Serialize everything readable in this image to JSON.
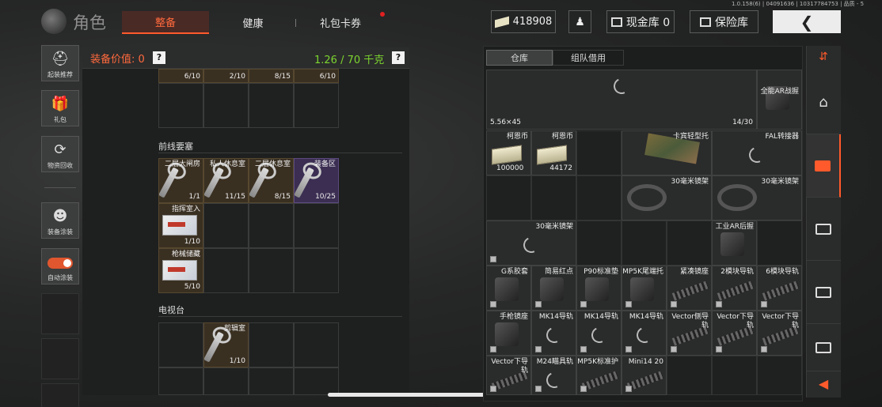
{
  "version": "1.0.158(6) | 04091636 | 10317784753 | 品质 - 5",
  "title": "角色",
  "tabs": [
    "整备",
    "健康",
    "礼包卡券"
  ],
  "header": {
    "currency": "418908",
    "cash_vault": "现金库 0",
    "safe": "保险库"
  },
  "left_buttons": [
    "起装推荐",
    "礼包",
    "物资回收",
    "装备涂装",
    "自动涂装"
  ],
  "equip": {
    "value_label": "装备价值: 0",
    "help": "?",
    "weight": "1.26 / 70 千克",
    "top_counts": [
      "6/10",
      "2/10",
      "8/15",
      "6/10"
    ],
    "sections": [
      "前线要塞",
      "电视台"
    ],
    "frontline": [
      {
        "name": "二层大闸房",
        "count": "1/1",
        "kind": "key"
      },
      {
        "name": "私人休息室",
        "count": "11/15",
        "kind": "key"
      },
      {
        "name": "二层休息室",
        "count": "8/15",
        "kind": "key"
      },
      {
        "name": "装备区",
        "count": "10/25",
        "kind": "key",
        "purple": true
      },
      {
        "name": "指挥室入",
        "count": "1/10",
        "kind": "card"
      },
      {
        "name": "枪械储藏",
        "count": "5/10",
        "kind": "card"
      }
    ],
    "tv": [
      {
        "name": "剪辑室",
        "count": "1/10",
        "kind": "key"
      }
    ]
  },
  "warehouse": {
    "tabs": [
      "仓库",
      "组队借用"
    ],
    "items": {
      "ammo": "5.56×45",
      "ammo_count": "14/30",
      "grip": "全能AR战握",
      "coin1": "柯恩币",
      "coin1_count": "100000",
      "coin2": "柯恩币",
      "coin2_count": "44172",
      "stock": "卡宾轻型托",
      "fal": "FAL转接器",
      "mount1": "30毫米镜架",
      "mount2": "30毫米镜架",
      "mount3": "30毫米镜架",
      "argrip": "工业AR后握",
      "r1": [
        "G系胶套",
        "简易红点",
        "P90标准垫",
        "MP5K尾端托",
        "紧凑镜座",
        "2模块导轨",
        "6模块导轨"
      ],
      "r2": [
        "手枪镜座",
        "MK14导轨",
        "MK14导轨",
        "MK14导轨",
        "Vector侧导轨",
        "Vector下导轨",
        "Vector下导轨"
      ],
      "r3": [
        "Vector下导轨",
        "M24瞄具轨",
        "MP5K标准护",
        "Mini14 20"
      ]
    }
  }
}
